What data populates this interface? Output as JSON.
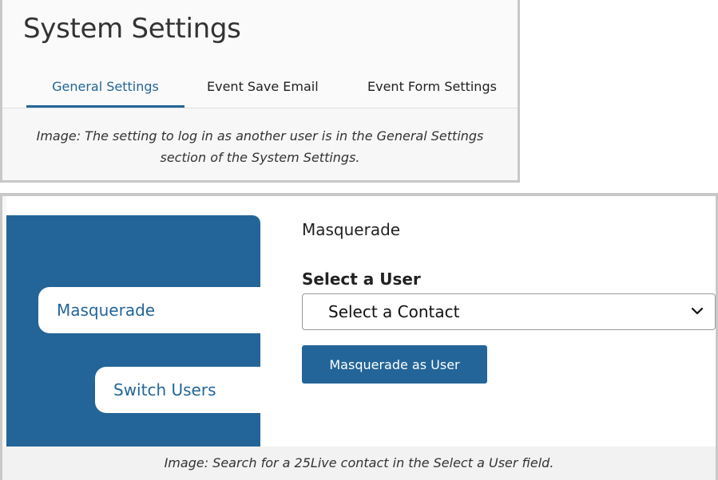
{
  "figure1": {
    "title": "System Settings",
    "tabs": [
      {
        "label": "General Settings",
        "active": true
      },
      {
        "label": "Event Save Email",
        "active": false
      },
      {
        "label": "Event Form Settings",
        "active": false
      }
    ],
    "caption_line1": "Image: The setting to log in as another user is in the General Settings",
    "caption_line2": "section of the System Settings."
  },
  "figure2": {
    "sidebar": {
      "items": [
        {
          "label": "Masquerade"
        },
        {
          "label": "Switch Users"
        }
      ]
    },
    "panel_title": "Masquerade",
    "select_user": {
      "label": "Select a User",
      "value": "Select a Contact",
      "icon": "chevron-down-icon"
    },
    "masquerade_button": "Masquerade as User",
    "caption": "Image: Search for a 25Live contact in the Select a User field."
  },
  "colors": {
    "accent": "#236598",
    "caption_bg": "#f2f2f2",
    "frame": "#c8c8c8"
  }
}
